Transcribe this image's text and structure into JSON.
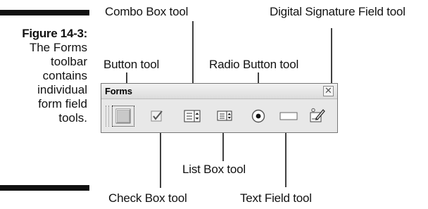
{
  "figure": {
    "number_label": "Figure 14-3:",
    "caption_lines": "The Forms\ntoolbar\ncontains\nindividual\nform field\ntools."
  },
  "toolbar": {
    "title": "Forms",
    "close_glyph": "✕",
    "tools": [
      {
        "icon": "button-tool-icon",
        "label": "Button tool"
      },
      {
        "icon": "check-box-tool-icon",
        "label": "Check Box tool"
      },
      {
        "icon": "combo-box-tool-icon",
        "label": "Combo Box tool"
      },
      {
        "icon": "list-box-tool-icon",
        "label": "List Box tool"
      },
      {
        "icon": "radio-button-tool-icon",
        "label": "Radio Button tool"
      },
      {
        "icon": "text-field-tool-icon",
        "label": "Text Field tool"
      },
      {
        "icon": "digital-signature-field-tool-icon",
        "label": "Digital Signature Field tool"
      }
    ]
  },
  "colors": {
    "toolbar_bg": "#e8e8e8",
    "callout_line": "#111111"
  }
}
